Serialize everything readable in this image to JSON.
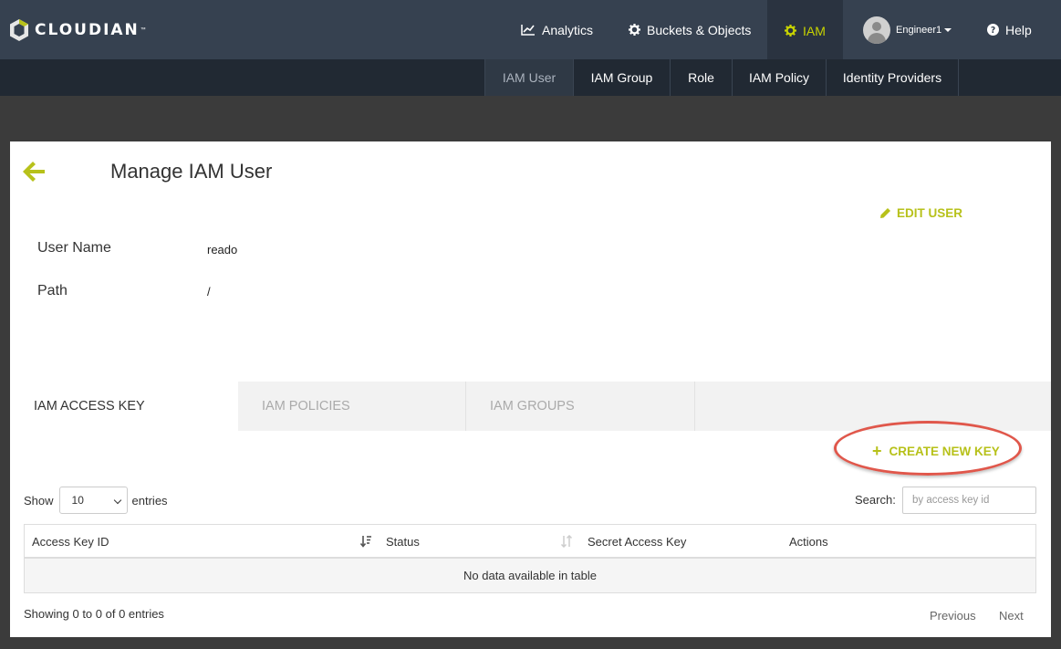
{
  "app": {
    "brand": "CLOUDIAN",
    "brand_mark": "™"
  },
  "nav": {
    "analytics": "Analytics",
    "buckets": "Buckets & Objects",
    "iam": "IAM",
    "user": "Engineer1",
    "help": "Help"
  },
  "subnav": [
    "IAM User",
    "IAM Group",
    "Role",
    "IAM Policy",
    "Identity Providers"
  ],
  "page": {
    "title": "Manage IAM User",
    "edit_user": "EDIT USER",
    "fields": [
      {
        "label": "User Name",
        "value": "reado"
      },
      {
        "label": "Path",
        "value": "/"
      }
    ]
  },
  "tabs": [
    "IAM ACCESS KEY",
    "IAM POLICIES",
    "IAM GROUPS"
  ],
  "actions": {
    "create_key": "CREATE NEW KEY",
    "create_icon": "+"
  },
  "table": {
    "show_prefix": "Show",
    "show_value": "10",
    "show_suffix": "entries",
    "search_label": "Search:",
    "search_placeholder": "by access key id",
    "columns": [
      "Access Key ID",
      "Status",
      "Secret Access Key",
      "Actions"
    ],
    "empty": "No data available in table",
    "info": "Showing 0 to 0 of 0 entries",
    "previous": "Previous",
    "next": "Next"
  },
  "colors": {
    "accent": "#b7c11a",
    "topbar": "#364150",
    "subnav": "#212933",
    "highlight": "#e0574b"
  },
  "icons": [
    "logo-cube-icon",
    "chart-line-icon",
    "gear-icon",
    "user-avatar-icon",
    "question-circle-icon",
    "arrow-left-icon",
    "pencil-icon",
    "plus-icon",
    "sort-icon"
  ]
}
